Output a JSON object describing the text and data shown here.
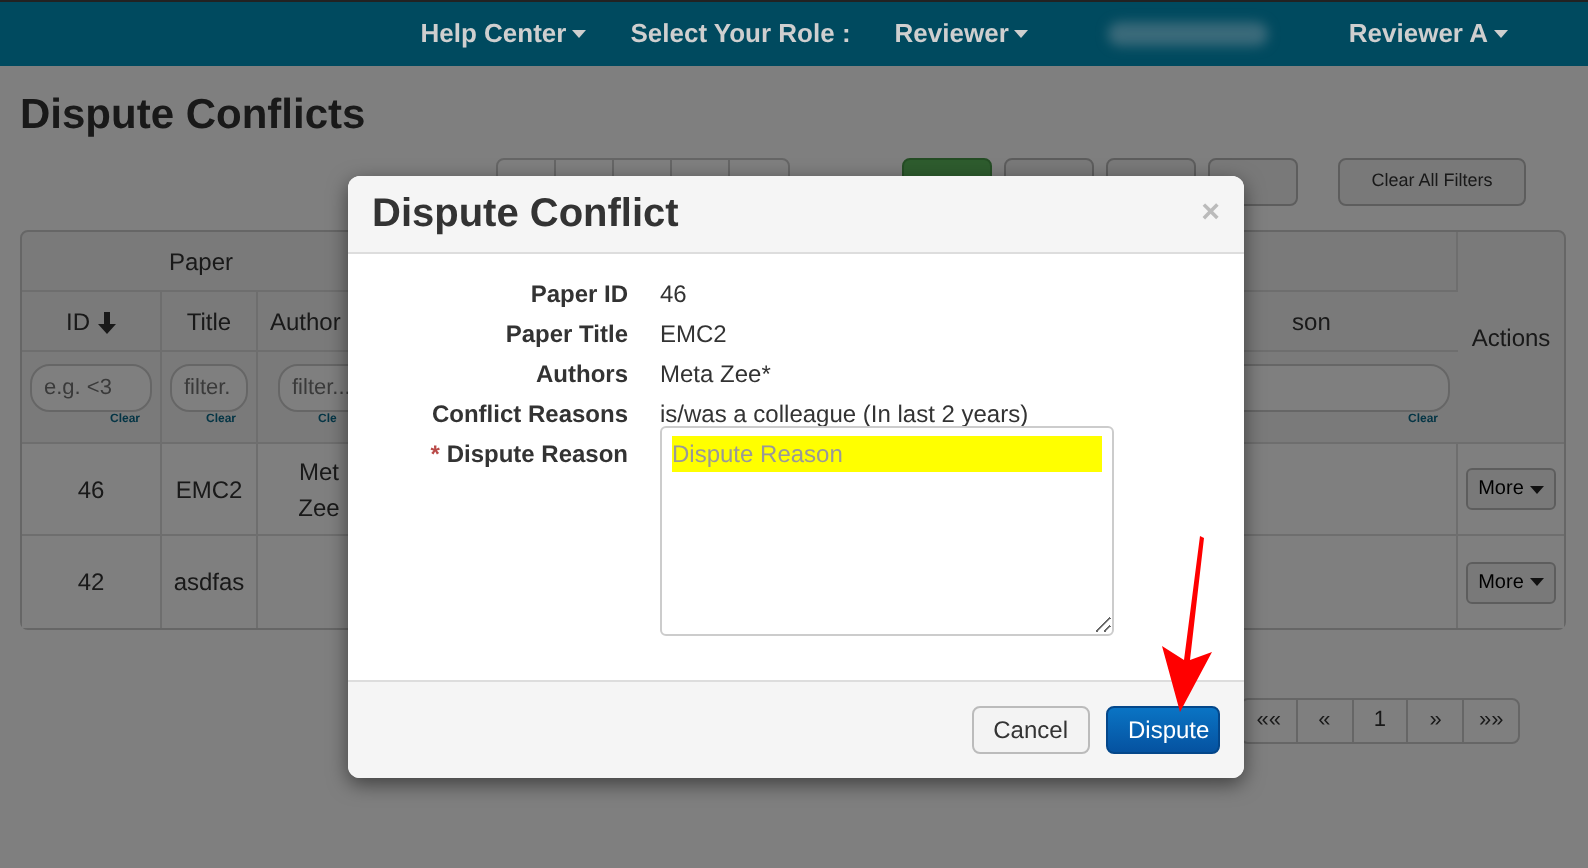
{
  "navbar": {
    "items": [
      {
        "label": "Help Center",
        "kind": "menu"
      },
      {
        "label": "Select Your Role :",
        "kind": "text"
      },
      {
        "label": "Reviewer",
        "kind": "menu"
      },
      {
        "label": "Reviewer A",
        "kind": "menu"
      }
    ]
  },
  "page_title": "Dispute Conflicts",
  "toolbar": {
    "page_size_buttons": [
      {
        "selected": true
      },
      {
        "selected": false
      },
      {
        "selected": false
      },
      {
        "selected": false
      }
    ],
    "clear_filters": "Clear All Filters"
  },
  "table": {
    "group_header": "Paper",
    "columns": [
      {
        "label": "ID",
        "sorted": true
      },
      {
        "label": "Title",
        "sorted": false
      },
      {
        "label": "Author",
        "sorted": false
      },
      {
        "label": "son",
        "sorted": false
      },
      {
        "label": "Actions",
        "sorted": false
      }
    ],
    "filters": [
      {
        "placeholder": "e.g. <3",
        "clear": "Clear"
      },
      {
        "placeholder": "filter.",
        "clear": "Clear"
      },
      {
        "placeholder": "filter...",
        "clear": "Cle"
      },
      {
        "clear": "Clear"
      }
    ],
    "rows": [
      {
        "id": "46",
        "title": "EMC2",
        "authors": [
          "Met",
          "Zee"
        ],
        "action": "More"
      },
      {
        "id": "42",
        "title": "asdfas",
        "authors": [],
        "action": "More"
      }
    ]
  },
  "pagination": [
    "««",
    "«",
    "1",
    "»",
    "»»"
  ],
  "modal": {
    "title": "Dispute Conflict",
    "close": "×",
    "fields": [
      {
        "kind": "text",
        "label": "Paper ID",
        "value": "46"
      },
      {
        "kind": "text",
        "label": "Paper Title",
        "value": "EMC2"
      },
      {
        "kind": "text",
        "label": "Authors",
        "value": "Meta Zee*"
      },
      {
        "kind": "text",
        "label": "Conflict Reasons",
        "value": "is/was a colleague (In last 2 years)"
      },
      {
        "kind": "textarea",
        "label": "Dispute Reason",
        "required_mark": "*",
        "placeholder": "Dispute Reason",
        "highlighted": true
      }
    ],
    "buttons": [
      {
        "label": "Cancel",
        "primary": false
      },
      {
        "label": "Dispute",
        "primary": true
      }
    ]
  }
}
